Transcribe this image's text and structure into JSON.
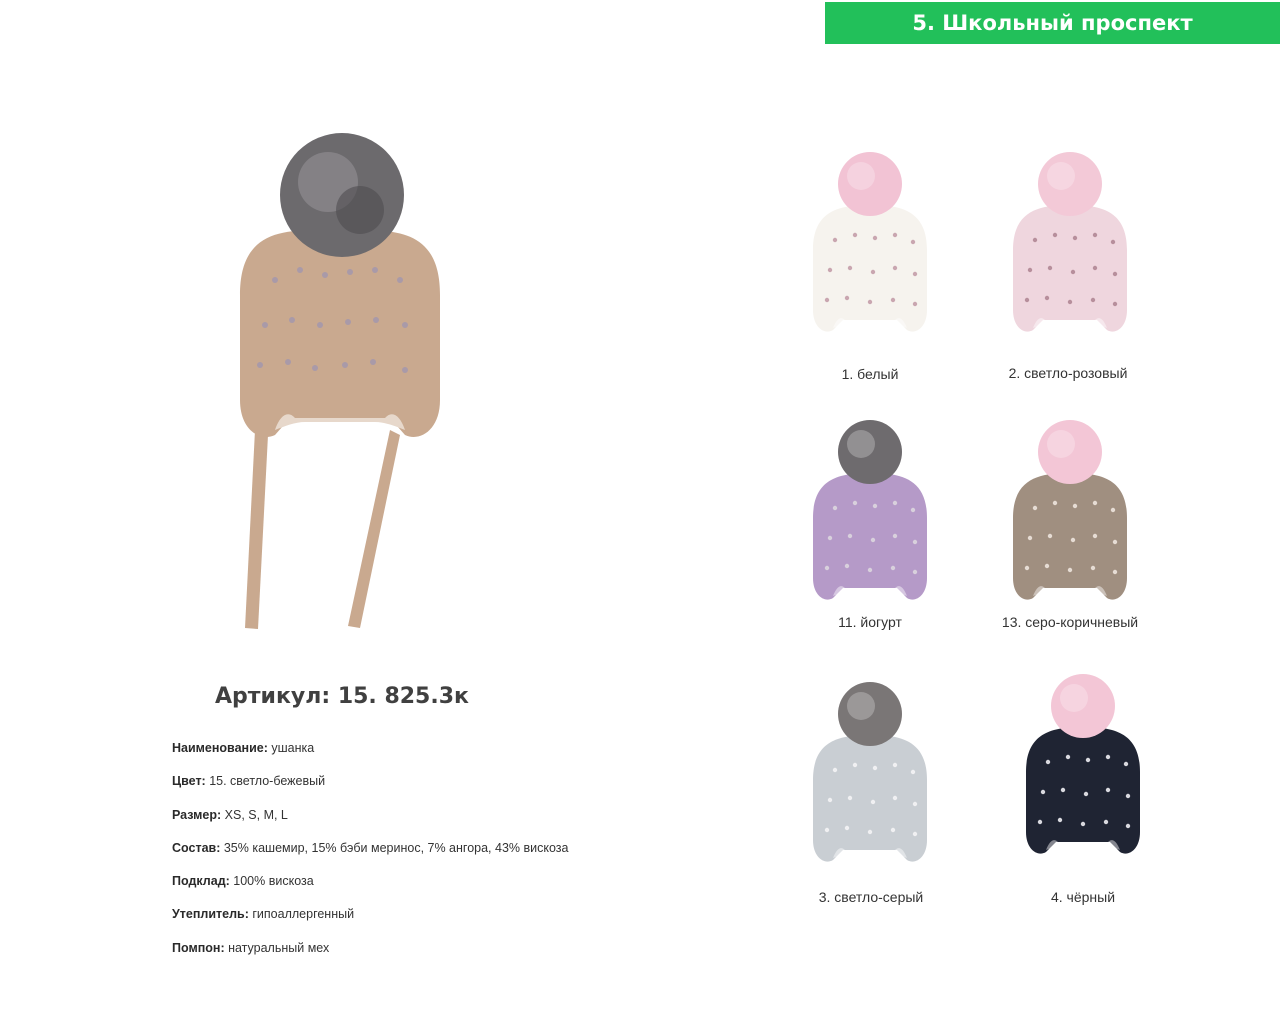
{
  "header": {
    "title": "5. Школьный проспект",
    "accent_color": "#22c05a"
  },
  "product": {
    "article": "Артикул: 15. 825.3к",
    "main_image": "beige-hat-with-grey-pompom-and-ties",
    "specs": [
      {
        "label": "Наименование:",
        "value": " ушанка"
      },
      {
        "label": "Цвет:",
        "value": " 15. светло-бежевый"
      },
      {
        "label": "Размер:",
        "value": "  XS, S, M, L"
      },
      {
        "label": "Состав:",
        "value": " 35% кашемир, 15% бэби меринос, 7% ангора, 43% вискоза"
      },
      {
        "label": "Подклад:",
        "value": " 100% вискоза"
      },
      {
        "label": "Утеплитель:",
        "value": " гипоаллергенный"
      },
      {
        "label": "Помпон:",
        "value": " натуральный мех"
      }
    ]
  },
  "variants": [
    {
      "caption": "1. белый",
      "hat_color": "#f6f3ee",
      "pom_color": "#f2c3d4",
      "bead_color": "#c9a6b0"
    },
    {
      "caption": "2. светло-розовый",
      "hat_color": "#efd6de",
      "pom_color": "#f3c9d7",
      "bead_color": "#b78f9c"
    },
    {
      "caption": "11. йогурт",
      "hat_color": "#b59ac8",
      "pom_color": "#6e6b6e",
      "bead_color": "#d8d0dc"
    },
    {
      "caption": "13. серо-коричневый",
      "hat_color": "#a08f80",
      "pom_color": "#f3c6d6",
      "bead_color": "#e6dcd4"
    },
    {
      "caption": "3. светло-серый",
      "hat_color": "#c9ced3",
      "pom_color": "#7a7676",
      "bead_color": "#f0f0f2"
    },
    {
      "caption": "4. чёрный",
      "hat_color": "#1f2433",
      "pom_color": "#f3c6d6",
      "bead_color": "#d9d9df"
    }
  ]
}
